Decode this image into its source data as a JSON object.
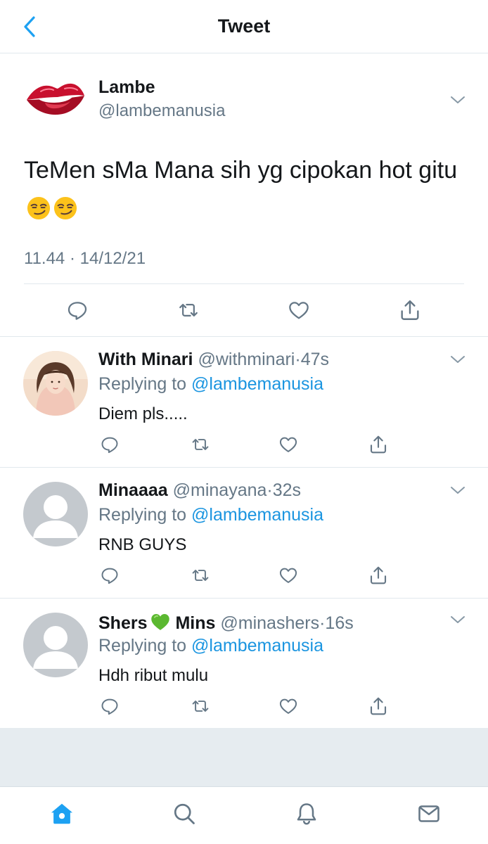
{
  "header": {
    "title": "Tweet"
  },
  "main_tweet": {
    "name": "Lambe",
    "handle": "@lambemanusia",
    "text": "TeMen sMa Mana sih yg cipokan hot gitu",
    "emoji": "smirking-face-emoji x2",
    "time": "11.44",
    "date": "14/12/21",
    "meta_separator": "·"
  },
  "replies": [
    {
      "name": "With Minari",
      "handle": "@withminari",
      "time": "47s",
      "replying_label": "Replying to",
      "mention": "@lambemanusia",
      "text": "Diem pls....."
    },
    {
      "name": "Minaaaa",
      "handle": "@minayana",
      "time": "32s",
      "replying_label": "Replying to",
      "mention": "@lambemanusia",
      "text": "RNB GUYS"
    },
    {
      "name_part1": "Shers",
      "name_part2": "Mins",
      "handle": "@minashers",
      "time": "16s",
      "replying_label": "Replying to",
      "mention": "@lambemanusia",
      "text": "Hdh ribut mulu"
    }
  ],
  "separator": "·",
  "colors": {
    "accent": "#1da1f2",
    "mention": "#1b95e0",
    "secondary_text": "#657786",
    "icon_gray": "#657786",
    "divider": "#e1e8ed",
    "background_gray": "#e6ecf0"
  },
  "icons": {
    "back": "chevron-left-icon",
    "caret": "chevron-down-icon",
    "reply": "reply-icon",
    "retweet": "retweet-icon",
    "like": "heart-icon",
    "share": "share-icon",
    "home": "home-icon",
    "search": "search-icon",
    "notifications": "bell-icon",
    "messages": "mail-icon"
  }
}
